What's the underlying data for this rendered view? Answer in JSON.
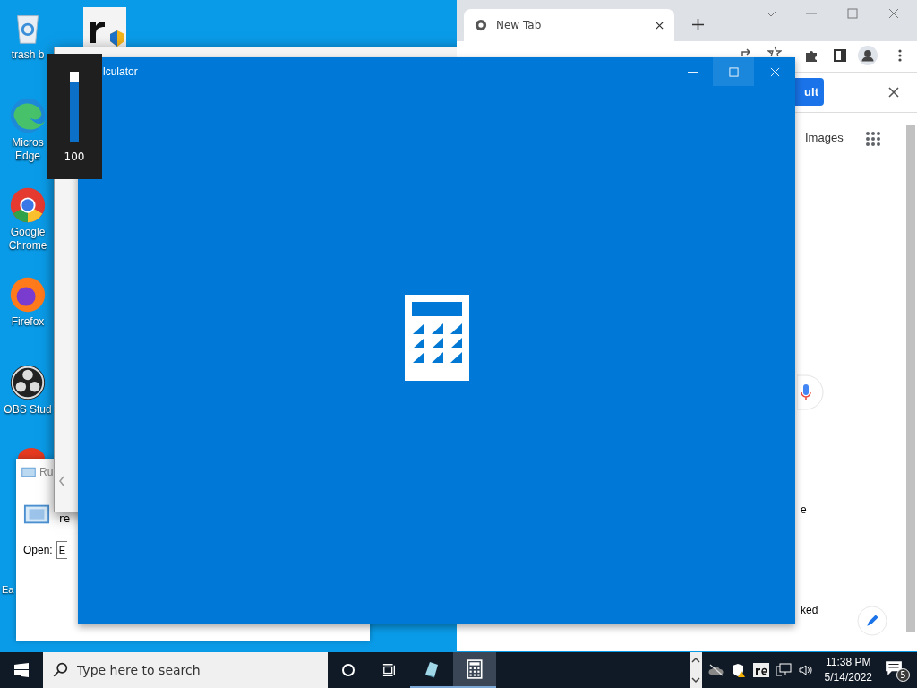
{
  "desktop": {
    "icons": [
      {
        "kind": "trash",
        "label": "trash b"
      },
      {
        "kind": "edge",
        "label": "Micros\nEdge"
      },
      {
        "kind": "chrome",
        "label": "Google\nChrome"
      },
      {
        "kind": "firefox",
        "label": "Firefox"
      },
      {
        "kind": "obs",
        "label": "OBS Stud"
      },
      {
        "kind": "red",
        "label": "Ea"
      }
    ]
  },
  "volume_flyout": {
    "level": 1,
    "reading": "100"
  },
  "browser": {
    "tabs": [
      {
        "label": "New Tab",
        "selected": true
      }
    ],
    "button": "ult",
    "link": "Images",
    "texts": [
      "e",
      "ked"
    ]
  },
  "run_dialog": {
    "title": "Ru",
    "prompt": "re",
    "open_label": "Open:",
    "value": "E"
  },
  "calculator": {
    "title": "lculator"
  },
  "taskbar": {
    "search_placeholder": "Type here to search",
    "apps": [
      {
        "kind": "notepad",
        "selected": false
      },
      {
        "kind": "calculator",
        "selected": true
      }
    ],
    "time": "11:38 PM",
    "date": "5/14/2022",
    "notifications": "5"
  }
}
